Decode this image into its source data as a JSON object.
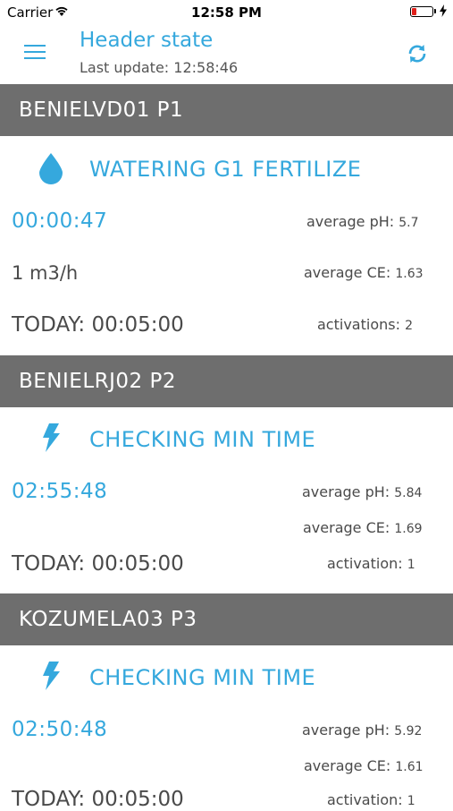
{
  "status_bar": {
    "carrier": "Carrier",
    "time": "12:58 PM",
    "battery_color": "#e0201b"
  },
  "header": {
    "title": "Header state",
    "last_update": "Last update: 12:58:46",
    "accent": "#35a8dd",
    "menu_icon": "hamburger-menu-icon",
    "refresh_icon": "refresh-icon"
  },
  "devices": [
    {
      "name": "BENIELVD01 P1",
      "state_icon": "water-drop-icon",
      "state": "WATERING G1 FERTILIZE",
      "timer": "00:00:47",
      "flow": "1 m3/h",
      "today": "TODAY: 00:05:00",
      "ph_label": "average pH:",
      "ph_value": "5.7",
      "ce_label": "average CE:",
      "ce_value": "1.63",
      "activations_label": "activations:",
      "activations_value": "2"
    },
    {
      "name": "BENIELRJ02 P2",
      "state_icon": "lightning-bolt-icon",
      "state": "CHECKING MIN TIME",
      "timer": "02:55:48",
      "today": "TODAY: 00:05:00",
      "ph_label": "average pH:",
      "ph_value": "5.84",
      "ce_label": "average CE:",
      "ce_value": "1.69",
      "activations_label": "activation:",
      "activations_value": "1"
    },
    {
      "name": "KOZUMELA03 P3",
      "state_icon": "lightning-bolt-icon",
      "state": "CHECKING MIN TIME",
      "timer": "02:50:48",
      "today": "TODAY: 00:05:00",
      "ph_label": "average pH:",
      "ph_value": "5.92",
      "ce_label": "average CE:",
      "ce_value": "1.61",
      "activations_label": "activation:",
      "activations_value": "1"
    }
  ]
}
